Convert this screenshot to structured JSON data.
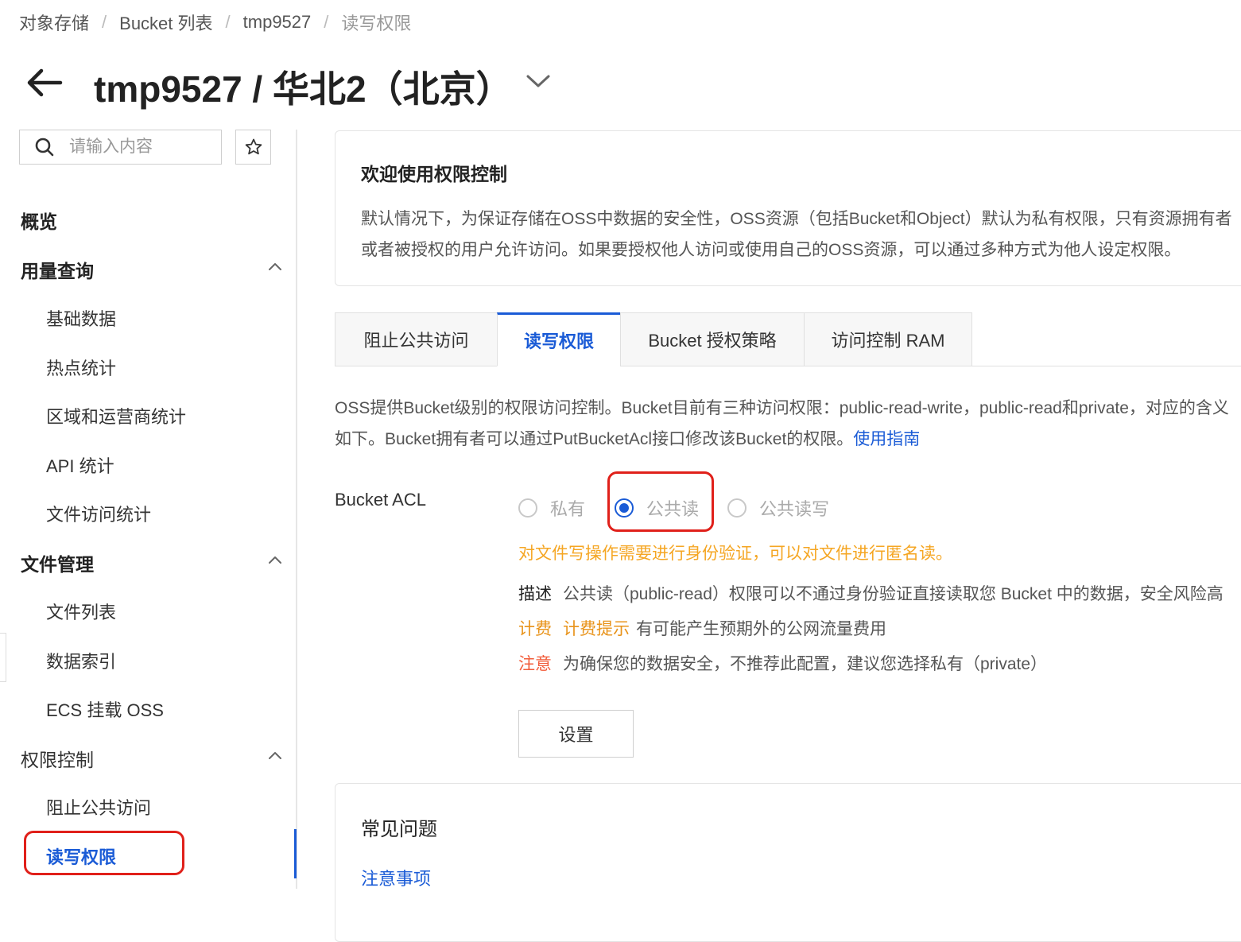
{
  "breadcrumb": [
    "对象存储",
    "Bucket 列表",
    "tmp9527",
    "读写权限"
  ],
  "title": "tmp9527 / 华北2（北京）",
  "sidebar": {
    "search_placeholder": "请输入内容",
    "overview": "概览",
    "groups": [
      {
        "label": "用量查询",
        "items": [
          "基础数据",
          "热点统计",
          "区域和运营商统计",
          "API 统计",
          "文件访问统计"
        ]
      },
      {
        "label": "文件管理",
        "items": [
          "文件列表",
          "数据索引",
          "ECS 挂载 OSS"
        ]
      },
      {
        "label": "权限控制",
        "items": [
          "阻止公共访问",
          "读写权限"
        ]
      }
    ],
    "active_item": "读写权限"
  },
  "welcome": {
    "title": "欢迎使用权限控制",
    "text": "默认情况下，为保证存储在OSS中数据的安全性，OSS资源（包括Bucket和Object）默认为私有权限，只有资源拥有者或者被授权的用户允许访问。如果要授权他人访问或使用自己的OSS资源，可以通过多种方式为他人设定权限。"
  },
  "tabs": [
    "阻止公共访问",
    "读写权限",
    "Bucket 授权策略",
    "访问控制 RAM"
  ],
  "active_tab": "读写权限",
  "description": {
    "text": "OSS提供Bucket级别的权限访问控制。Bucket目前有三种访问权限：public-read-write，public-read和private，对应的含义如下。Bucket拥有者可以通过PutBucketAcl接口修改该Bucket的权限。",
    "link": "使用指南"
  },
  "acl": {
    "label": "Bucket ACL",
    "options": [
      "私有",
      "公共读",
      "公共读写"
    ],
    "selected": "公共读",
    "warning": "对文件写操作需要进行身份验证，可以对文件进行匿名读。",
    "desc_tag": "描述",
    "desc_text": "公共读（public-read）权限可以不通过身份验证直接读取您 Bucket 中的数据，安全风险高",
    "billing_tag": "计费",
    "billing_hint": "计费提示",
    "billing_text": "有可能产生预期外的公网流量费用",
    "note_tag": "注意",
    "note_text": "为确保您的数据安全，不推荐此配置，建议您选择私有（private）",
    "button": "设置"
  },
  "faq": {
    "title": "常见问题",
    "link": "注意事项"
  },
  "colors": {
    "accent": "#1a5bd6",
    "highlight": "#e0201a",
    "warning": "#f5a623",
    "danger": "#f25c3a"
  }
}
